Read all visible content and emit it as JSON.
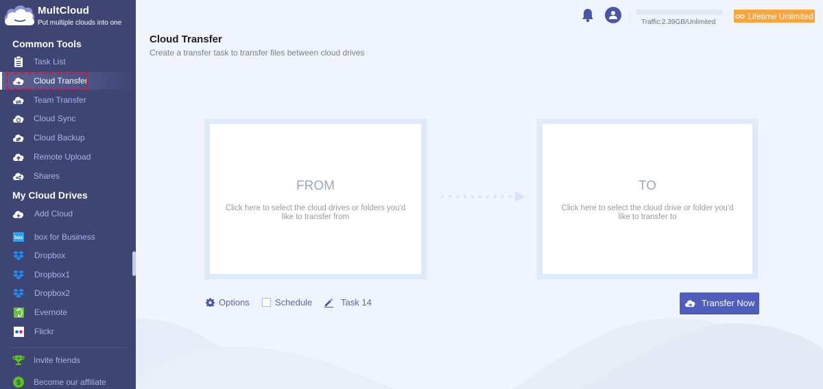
{
  "brand": {
    "name": "MultCloud",
    "tagline": "Put multiple clouds into one"
  },
  "sidebar": {
    "common_tools_title": "Common Tools",
    "tools": [
      {
        "label": "Task List",
        "icon": "clipboard-icon"
      },
      {
        "label": "Cloud Transfer",
        "icon": "cloud-transfer-icon",
        "active": true
      },
      {
        "label": "Team Transfer",
        "icon": "team-transfer-icon"
      },
      {
        "label": "Cloud Sync",
        "icon": "cloud-sync-icon"
      },
      {
        "label": "Cloud Backup",
        "icon": "cloud-backup-icon"
      },
      {
        "label": "Remote Upload",
        "icon": "remote-upload-icon"
      },
      {
        "label": "Shares",
        "icon": "share-icon"
      }
    ],
    "my_drives_title": "My Cloud Drives",
    "add_cloud_label": "Add Cloud",
    "drives": [
      {
        "label": "box for Business",
        "icon": "box-icon"
      },
      {
        "label": "Dropbox",
        "icon": "dropbox-icon"
      },
      {
        "label": "Dropbox1",
        "icon": "dropbox-icon"
      },
      {
        "label": "Dropbox2",
        "icon": "dropbox-icon"
      },
      {
        "label": "Evernote",
        "icon": "evernote-icon"
      },
      {
        "label": "Flickr",
        "icon": "flickr-icon"
      }
    ],
    "footer": [
      {
        "label": "Invite friends",
        "icon": "trophy-icon"
      },
      {
        "label": "Become our affiliate",
        "icon": "dollar-icon"
      }
    ]
  },
  "topbar": {
    "traffic_text": "Traffic:2.39GB/Unlimited",
    "traffic_used_fraction": 0,
    "plan_label": "Lifetime Unlimited"
  },
  "page": {
    "title": "Cloud Transfer",
    "subtitle": "Create a transfer task to transfer files between cloud drives"
  },
  "from_panel": {
    "title": "FROM",
    "description": "Click here to select the cloud drives or folders you'd like to transfer from"
  },
  "to_panel": {
    "title": "TO",
    "description": "Click here to select the cloud drive or folder you'd like to transfer to"
  },
  "options": {
    "options_label": "Options",
    "schedule_label": "Schedule",
    "task_name": "Task 14",
    "transfer_button": "Transfer Now"
  },
  "colors": {
    "sidebar_bg": "#3e4573",
    "accent": "#4f5ebc",
    "plan_badge": "#f9a43d",
    "highlight_box": "#e0142b"
  }
}
